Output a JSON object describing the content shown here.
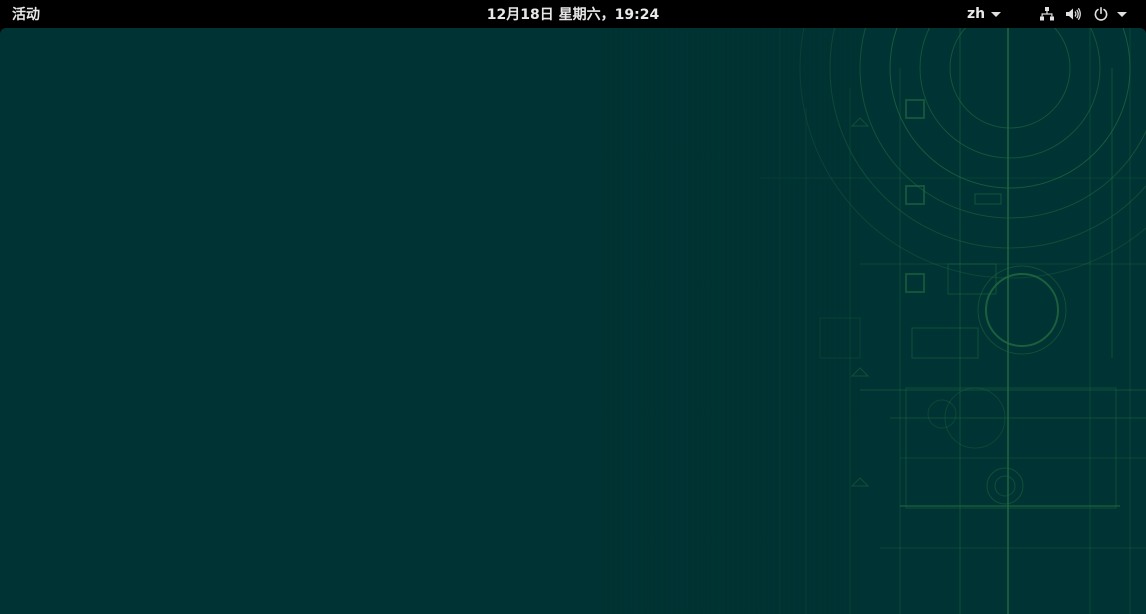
{
  "topbar": {
    "activities_label": "活动",
    "clock_text": "12月18日 星期六，19:24",
    "language_label": "zh",
    "status_icons": [
      "network-icon",
      "volume-icon",
      "power-icon"
    ],
    "background_color": "#000000",
    "text_color": "#e8e8e8"
  },
  "desktop": {
    "background_color": "#003333",
    "wallpaper_line_color": "#3f9a4c"
  }
}
